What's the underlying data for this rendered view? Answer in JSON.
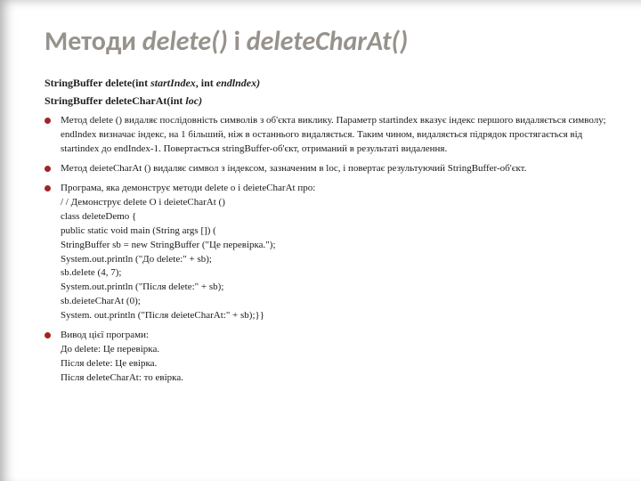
{
  "title": {
    "prefix": "Методи ",
    "m1": "delete()",
    "mid": " і ",
    "m2": "deleteCharAt()"
  },
  "sig1": {
    "cls": "StringBuffer delete(int ",
    "p1": "startIndex",
    "mid": ", int ",
    "p2": "endlndex)"
  },
  "sig2": {
    "cls": "StringBuffer deleteCharAt(int ",
    "p1": "loc)"
  },
  "bullets": {
    "b1": "Метод delete () видаляє послідовність символів з об'єкта виклику. Параметр startindex вказує індекс першого видаляється символу; endlndex визначає індекс, на 1 більший, ніж в останнього видаляється. Таким чином, видаляється підрядок простягається від startindex до endIndex-1. Повертається stringBuffer-об'єкт, отриманий в результаті видалення.",
    "b2": "Метод deieteCharAt () видаляє символ з індексом, зазначеним в loс, і повертає результуючий StringBuffer-об'єкт.",
    "b3_intro": "Програма, яка демонструє методи delete о і deieteCharAt про:",
    "b3_lines": [
      "/ / Демонструє delete О і deieteCharAt ()",
      "class deleteDemo {",
      "public static void main (String args []) (",
      "StringBuffer sb = new StringBuffer (\"Це перевірка.\");",
      "System.out.println (\"До delete:\" + sb);",
      "sb.delete (4, 7);",
      "System.out.println (\"Після delete:\" + sb);",
      "sb.deieteCharAt (0);",
      "System. out.println (\"Після deieteCharAt:\" + sb);}}"
    ],
    "b4_intro": "Вивод цієї програми:",
    "b4_lines": [
      "До delete: Це перевірка.",
      "Після delete: Це евірка.",
      "Після deleteCharAt: то евірка."
    ]
  }
}
